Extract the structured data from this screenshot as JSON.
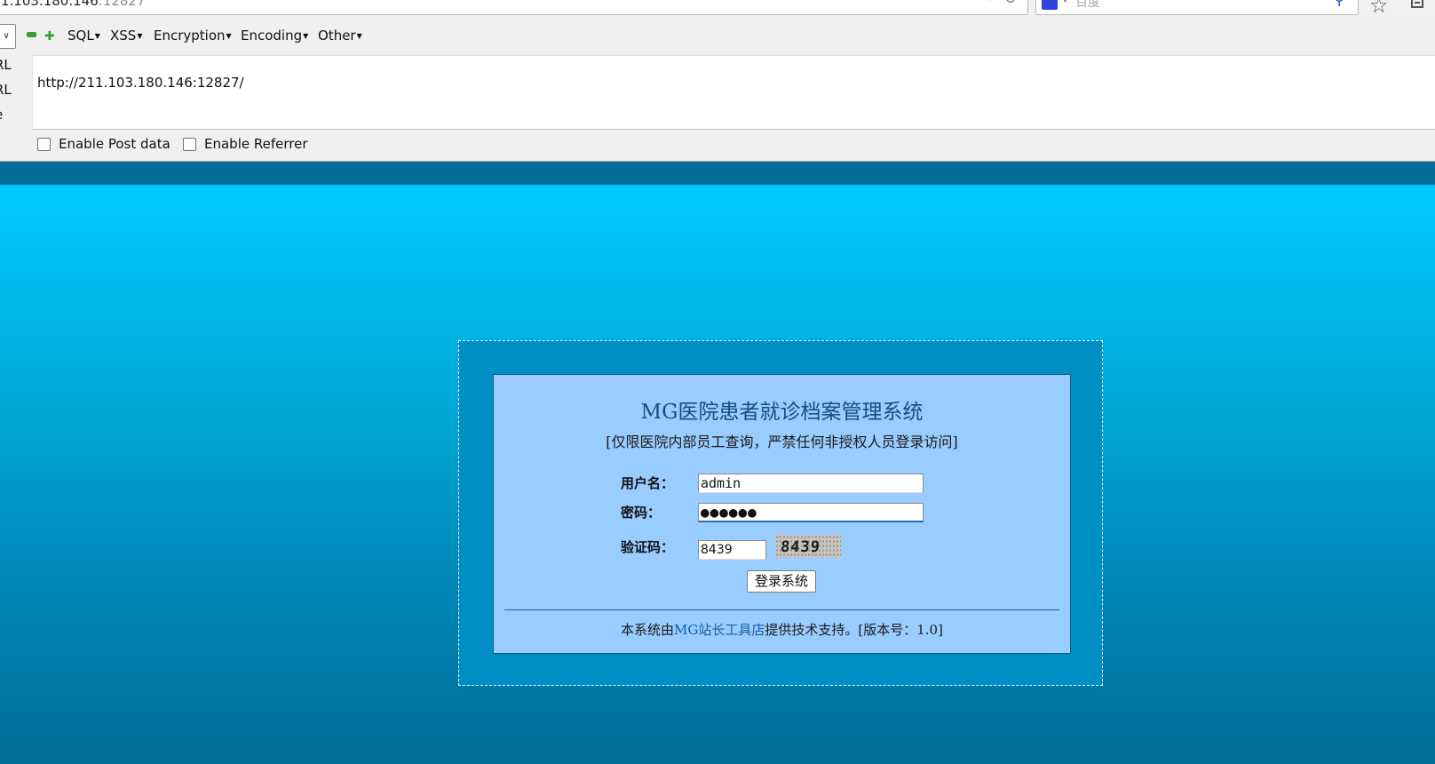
{
  "browser": {
    "url_host": "1.103.180.146",
    "url_port": ":12827",
    "search_placeholder": "百度"
  },
  "hackbar": {
    "menus": [
      {
        "label": "SQL"
      },
      {
        "label": "XSS"
      },
      {
        "label": "Encryption"
      },
      {
        "label": "Encoding"
      },
      {
        "label": "Other"
      }
    ],
    "side_labels": [
      "RL",
      "RL",
      "e"
    ],
    "url_value": "http://211.103.180.146:12827/",
    "checkboxes": [
      {
        "label": "Enable Post data",
        "checked": false
      },
      {
        "label": "Enable Referrer",
        "checked": false
      }
    ]
  },
  "login": {
    "title": "MG医院患者就诊档案管理系统",
    "subtitle": "[仅限医院内部员工查询，严禁任何非授权人员登录访问]",
    "username_label": "用户名：",
    "username_value": "admin",
    "password_label": "密码：",
    "password_value": "●●●●●●",
    "captcha_label": "验证码：",
    "captcha_value": "8439",
    "captcha_image_text": "8439",
    "submit_label": "登录系统",
    "footer_prefix": "本系统由",
    "footer_link": "MG站长工具店",
    "footer_suffix": "提供技术支持。[版本号：1.0]"
  },
  "colors": {
    "page_top": "#00caff",
    "page_bottom": "#006d99",
    "panel": "#99ccff",
    "title": "#154f7f"
  }
}
